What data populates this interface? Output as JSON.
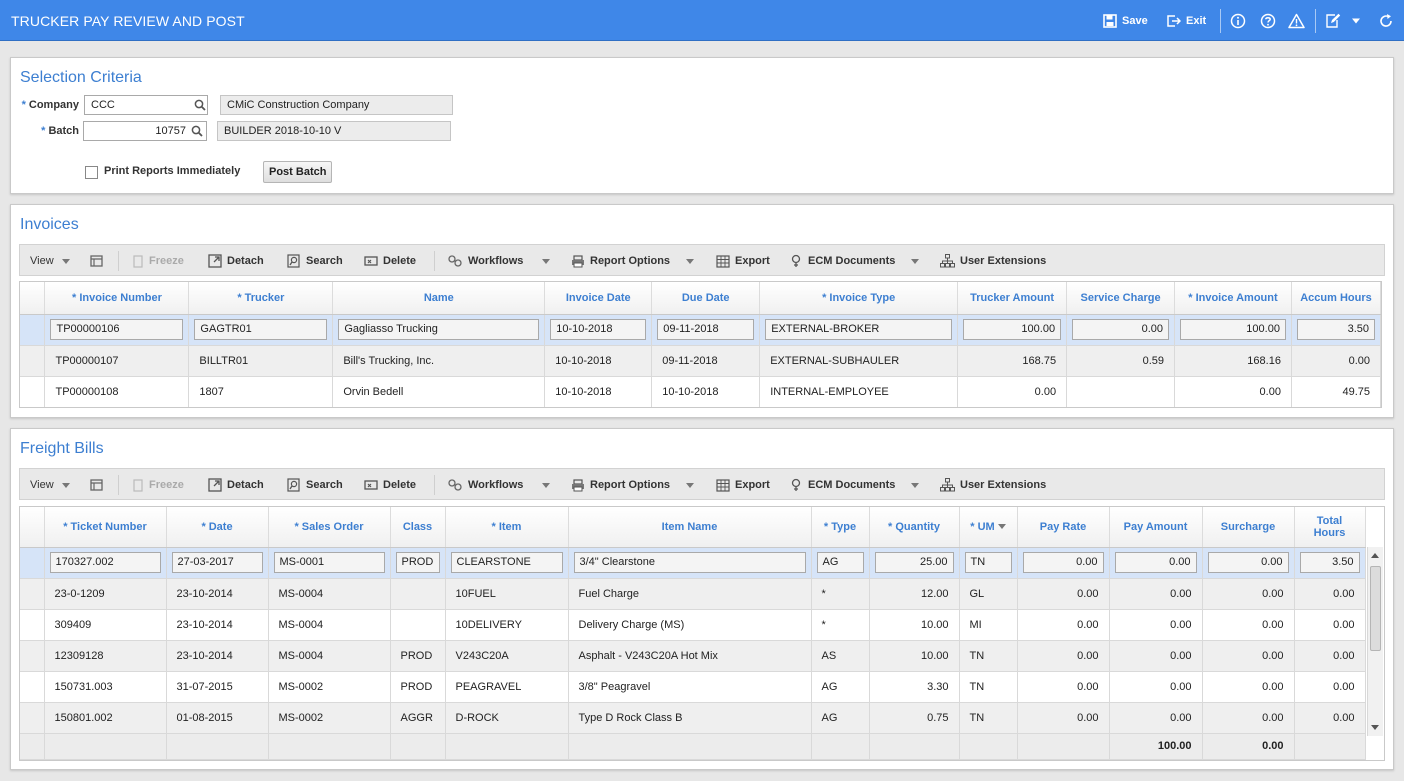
{
  "window": {
    "title": "TRUCKER PAY REVIEW AND POST",
    "save_label": "Save",
    "exit_label": "Exit"
  },
  "selection": {
    "title": "Selection Criteria",
    "company_label": "Company",
    "company_value": "CCC",
    "company_name": "CMiC Construction Company",
    "batch_label": "Batch",
    "batch_value": "10757",
    "batch_desc": "BUILDER 2018-10-10 V",
    "print_label": "Print Reports Immediately",
    "post_button": "Post Batch"
  },
  "toolbar": {
    "view": "View",
    "freeze": "Freeze",
    "detach": "Detach",
    "search": "Search",
    "delete": "Delete",
    "workflows": "Workflows",
    "report_options": "Report Options",
    "export": "Export",
    "ecm_documents": "ECM Documents",
    "user_extensions": "User Extensions"
  },
  "invoices": {
    "title": "Invoices",
    "columns": [
      "Invoice Number",
      "Trucker",
      "Name",
      "Invoice Date",
      "Due Date",
      "Invoice Type",
      "Trucker Amount",
      "Service Charge",
      "Invoice Amount",
      "Accum Hours"
    ],
    "rows": [
      [
        "TP00000106",
        "GAGTR01",
        "Gagliasso Trucking",
        "10-10-2018",
        "09-11-2018",
        "EXTERNAL-BROKER",
        "100.00",
        "0.00",
        "100.00",
        "3.50"
      ],
      [
        "TP00000107",
        "BILLTR01",
        "Bill's Trucking, Inc.",
        "10-10-2018",
        "09-11-2018",
        "EXTERNAL-SUBHAULER",
        "168.75",
        "0.59",
        "168.16",
        "0.00"
      ],
      [
        "TP00000108",
        "1807",
        "Orvin Bedell",
        "10-10-2018",
        "10-10-2018",
        "INTERNAL-EMPLOYEE",
        "0.00",
        "",
        "0.00",
        "49.75"
      ]
    ]
  },
  "freight": {
    "title": "Freight Bills",
    "columns": [
      "Ticket Number",
      "Date",
      "Sales Order",
      "Class",
      "Item",
      "Item Name",
      "Type",
      "Quantity",
      "UM",
      "Pay Rate",
      "Pay Amount",
      "Surcharge",
      "Total Hours"
    ],
    "rows": [
      [
        "170327.002",
        "27-03-2017",
        "MS-0001",
        "PROD",
        "CLEARSTONE",
        "3/4\" Clearstone",
        "AG",
        "25.00",
        "TN",
        "0.00",
        "0.00",
        "0.00",
        "3.50"
      ],
      [
        "23-0-1209",
        "23-10-2014",
        "MS-0004",
        "",
        "10FUEL",
        "Fuel Charge",
        "*",
        "12.00",
        "GL",
        "0.00",
        "0.00",
        "0.00",
        "0.00"
      ],
      [
        "309409",
        "23-10-2014",
        "MS-0004",
        "",
        "10DELIVERY",
        "Delivery Charge (MS)",
        "*",
        "10.00",
        "MI",
        "0.00",
        "0.00",
        "0.00",
        "0.00"
      ],
      [
        "12309128",
        "23-10-2014",
        "MS-0004",
        "PROD",
        "V243C20A",
        "Asphalt - V243C20A Hot Mix",
        "AS",
        "10.00",
        "TN",
        "0.00",
        "0.00",
        "0.00",
        "0.00"
      ],
      [
        "150731.003",
        "31-07-2015",
        "MS-0002",
        "PROD",
        "PEAGRAVEL",
        "3/8\" Peagravel",
        "AG",
        "3.30",
        "TN",
        "0.00",
        "0.00",
        "0.00",
        "0.00"
      ],
      [
        "150801.002",
        "01-08-2015",
        "MS-0002",
        "AGGR",
        "D-ROCK",
        "Type D Rock Class B",
        "AG",
        "0.75",
        "TN",
        "0.00",
        "0.00",
        "0.00",
        "0.00"
      ]
    ],
    "totals": {
      "pay_amount": "100.00",
      "surcharge": "0.00"
    }
  },
  "colors": {
    "titlebar": "#3f87e8",
    "accent": "#3d7fd1",
    "selected_row": "#d6e4f8"
  }
}
